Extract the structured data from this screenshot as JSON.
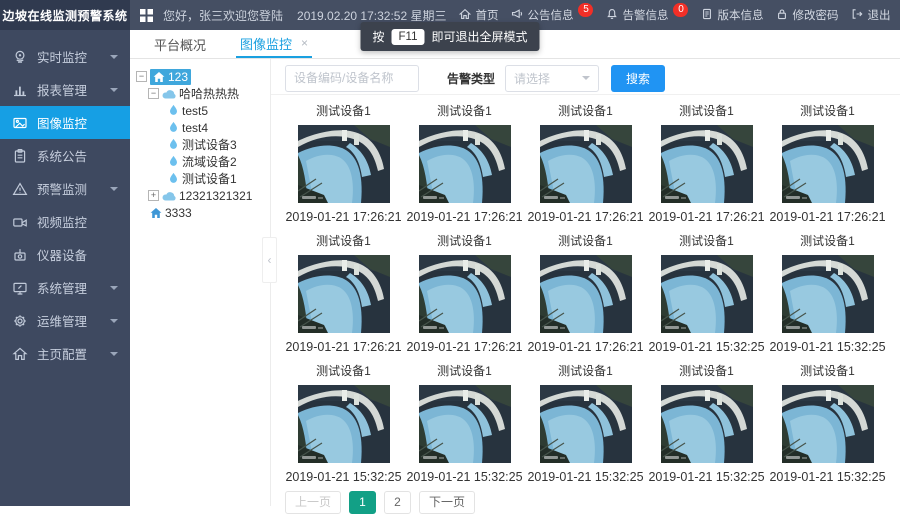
{
  "app": {
    "title": "边坡在线监测预警系统"
  },
  "topbar": {
    "greeting": "您好，张三欢迎您登陆",
    "datetime": "2019.02.20 17:32:52 星期三",
    "nav": [
      {
        "label": "首页",
        "icon": "home-icon"
      },
      {
        "label": "公告信息",
        "icon": "announcement-icon",
        "badge": "5"
      },
      {
        "label": "告警信息",
        "icon": "alarm-icon",
        "badge": "0"
      },
      {
        "label": "版本信息",
        "icon": "version-icon"
      },
      {
        "label": "修改密码",
        "icon": "password-icon"
      },
      {
        "label": "退出",
        "icon": "logout-icon"
      }
    ]
  },
  "toast": {
    "prefix": "按",
    "key": "F11",
    "suffix": "即可退出全屏模式"
  },
  "sidebar": {
    "items": [
      {
        "label": "实时监控",
        "icon": "realtime-monitor-icon",
        "arrow": true
      },
      {
        "label": "报表管理",
        "icon": "report-chart-icon",
        "arrow": true
      },
      {
        "label": "图像监控",
        "icon": "image-monitor-icon",
        "active": true
      },
      {
        "label": "系统公告",
        "icon": "system-notice-icon"
      },
      {
        "label": "预警监测",
        "icon": "warning-monitor-icon",
        "arrow": true
      },
      {
        "label": "视频监控",
        "icon": "video-monitor-icon"
      },
      {
        "label": "仪器设备",
        "icon": "instrument-icon"
      },
      {
        "label": "系统管理",
        "icon": "system-manage-icon",
        "arrow": true
      },
      {
        "label": "运维管理",
        "icon": "ops-manage-icon",
        "arrow": true
      },
      {
        "label": "主页配置",
        "icon": "homepage-config-icon",
        "arrow": true
      }
    ]
  },
  "tabs": {
    "overview": "平台概况",
    "image_monitor": "图像监控"
  },
  "tree": {
    "nodes": [
      {
        "label": "123",
        "level": 0,
        "icon": "house-icon",
        "expander": "open",
        "selected": true
      },
      {
        "label": "哈哈热热热",
        "level": 1,
        "icon": "cloud-icon",
        "expander": "open"
      },
      {
        "label": "test5",
        "level": 2,
        "icon": "drop-icon"
      },
      {
        "label": "test4",
        "level": 2,
        "icon": "drop-icon"
      },
      {
        "label": "测试设备3",
        "level": 2,
        "icon": "drop-icon"
      },
      {
        "label": "流域设备2",
        "level": 2,
        "icon": "drop-icon"
      },
      {
        "label": "测试设备1",
        "level": 2,
        "icon": "drop-icon"
      },
      {
        "label": "12321321321",
        "level": 1,
        "icon": "cloud-icon",
        "expander": "closed"
      },
      {
        "label": "3333",
        "level": 0,
        "icon": "house-icon"
      }
    ]
  },
  "filters": {
    "device_placeholder": "设备编码/设备名称",
    "alarm_type_label": "告警类型",
    "alarm_type_value": "请选择",
    "search_label": "搜索"
  },
  "cards": [
    {
      "title": "测试设备1",
      "time": "2019-01-21 17:26:21"
    },
    {
      "title": "测试设备1",
      "time": "2019-01-21 17:26:21"
    },
    {
      "title": "测试设备1",
      "time": "2019-01-21 17:26:21"
    },
    {
      "title": "测试设备1",
      "time": "2019-01-21 17:26:21"
    },
    {
      "title": "测试设备1",
      "time": "2019-01-21 17:26:21"
    },
    {
      "title": "测试设备1",
      "time": "2019-01-21 17:26:21"
    },
    {
      "title": "测试设备1",
      "time": "2019-01-21 17:26:21"
    },
    {
      "title": "测试设备1",
      "time": "2019-01-21 17:26:21"
    },
    {
      "title": "测试设备1",
      "time": "2019-01-21 15:32:25"
    },
    {
      "title": "测试设备1",
      "time": "2019-01-21 15:32:25"
    },
    {
      "title": "测试设备1",
      "time": "2019-01-21 15:32:25"
    },
    {
      "title": "测试设备1",
      "time": "2019-01-21 15:32:25"
    },
    {
      "title": "测试设备1",
      "time": "2019-01-21 15:32:25"
    },
    {
      "title": "测试设备1",
      "time": "2019-01-21 15:32:25"
    },
    {
      "title": "测试设备1",
      "time": "2019-01-21 15:32:25"
    }
  ],
  "pagination": {
    "prev": "上一页",
    "page1": "1",
    "page2": "2",
    "next": "下一页"
  },
  "icons": {
    "close": "×",
    "collapse": "‹",
    "expand_open": "−",
    "expand_closed": "+"
  },
  "colors": {
    "topbar_bg": "#454f63",
    "brand_bg": "#303a4f",
    "sidebar_bg": "#3e4960",
    "active_menu_blue": "#169fe4",
    "tab_blue": "#1aa0e0",
    "tree_selected": "#3fa7dc",
    "badge_red": "#f22f27",
    "search_button_blue": "#2094f3",
    "pagination_active_teal": "#12a086"
  }
}
